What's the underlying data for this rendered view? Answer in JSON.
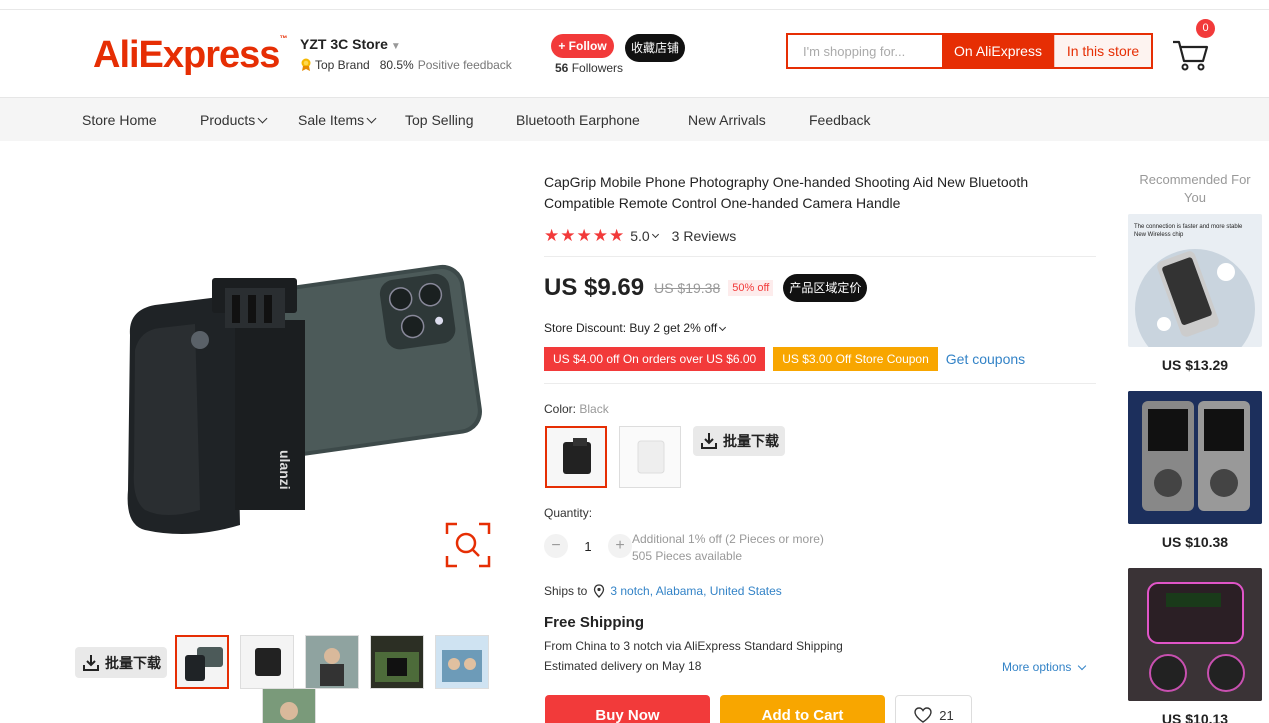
{
  "header": {
    "logo": "AliExpress",
    "store_name": "YZT 3C Store",
    "top_brand": "Top Brand",
    "feedback_pct": "80.5%",
    "feedback_label": "Positive feedback",
    "follow_label": "+ Follow",
    "favorite_label": "收藏店铺",
    "followers_count": "56",
    "followers_label": "Followers",
    "search_placeholder": "I'm shopping for...",
    "search_ali_label": "On AliExpress",
    "search_store_label": "In this store",
    "cart_count": "0"
  },
  "nav": {
    "items": [
      "Store Home",
      "Products",
      "Sale Items",
      "Top Selling",
      "Bluetooth Earphone",
      "New Arrivals",
      "Feedback"
    ]
  },
  "gallery": {
    "download_label": "批量下载"
  },
  "product": {
    "title": "CapGrip Mobile Phone Photography One-handed Shooting Aid New Bluetooth Compatible Remote Control One-handed Camera Handle",
    "stars": "★★★★★",
    "rating": "5.0",
    "reviews": "3 Reviews",
    "price": "US $9.69",
    "old_price": "US $19.38",
    "discount": "50% off",
    "region_badge": "产品区域定价",
    "store_discount": "Store Discount: Buy 2 get 2% off",
    "coupon_1": "US $4.00 off On orders over US $6.00",
    "coupon_2": "US $3.00 Off Store Coupon",
    "get_coupons": "Get coupons",
    "color_label": "Color:",
    "color_value": "Black",
    "download_label": "批量下载",
    "quantity_label": "Quantity:",
    "quantity": "1",
    "qty_note_1": "Additional 1% off (2 Pieces or more)",
    "qty_note_2": "505 Pieces available",
    "ships_to_label": "Ships to",
    "ships_to_location": "3 notch, Alabama, United States",
    "free_shipping": "Free Shipping",
    "ship_from": "From China to 3 notch via AliExpress Standard Shipping",
    "estimated": "Estimated delivery on May 18",
    "more_options": "More options",
    "buy_now": "Buy Now",
    "add_to_cart": "Add to Cart",
    "wish_count": "21"
  },
  "recommended": {
    "title": "Recommended For You",
    "items": [
      {
        "price": "US $13.29"
      },
      {
        "price": "US $10.38"
      },
      {
        "price": "US $10.13"
      }
    ]
  },
  "colors": {
    "accent": "#e62e04",
    "red": "#f23a3a",
    "orange": "#f8a600",
    "link": "#3383c7"
  }
}
